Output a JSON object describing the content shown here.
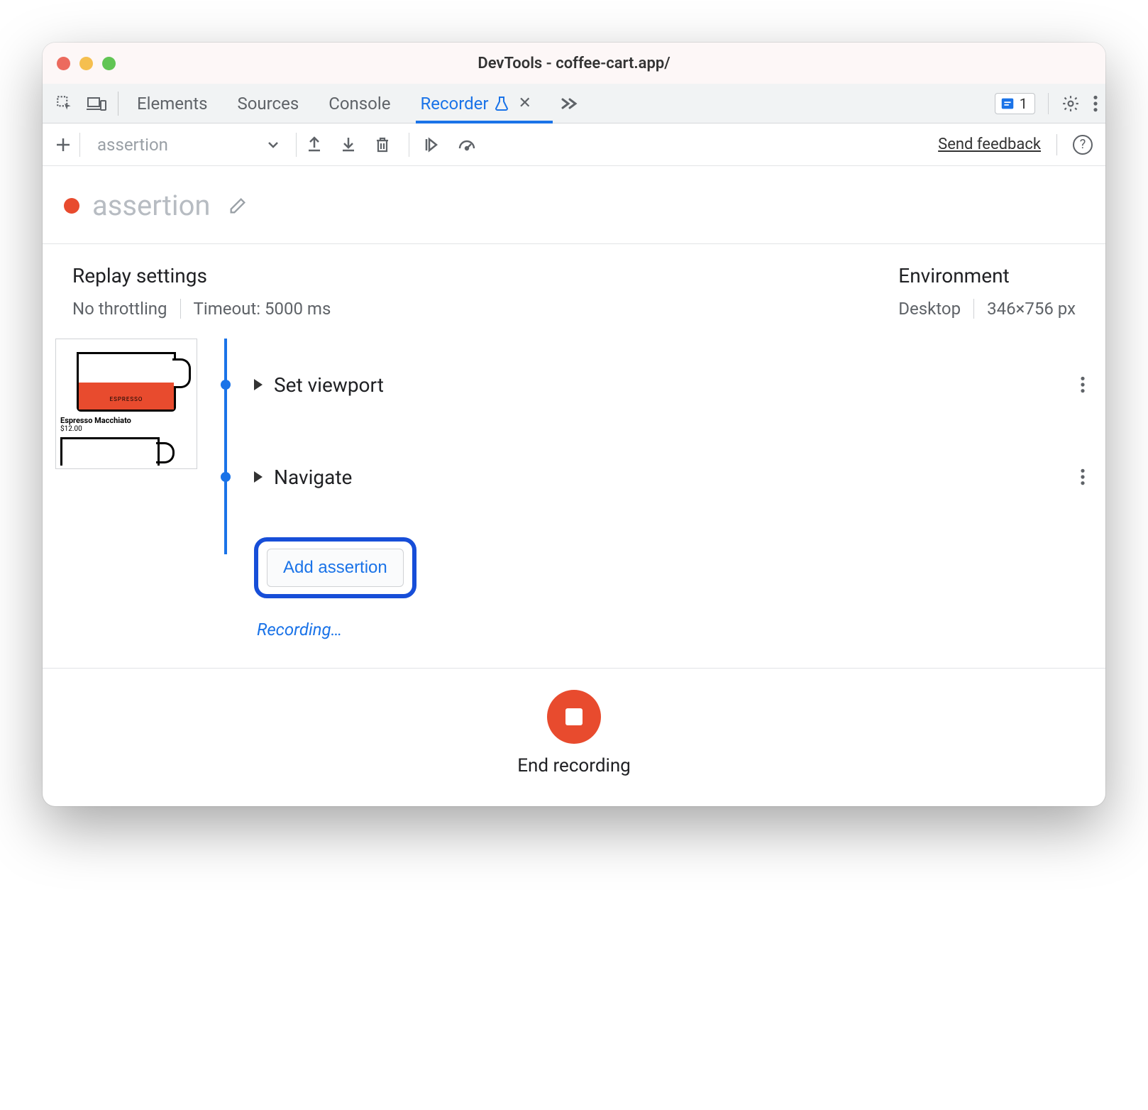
{
  "window": {
    "title": "DevTools - coffee-cart.app/"
  },
  "tabstrip": {
    "tabs": {
      "elements": "Elements",
      "sources": "Sources",
      "console": "Console",
      "recorder": "Recorder"
    },
    "issues_count": "1"
  },
  "subtoolbar": {
    "recording_name": "assertion",
    "send_feedback": "Send feedback"
  },
  "recording": {
    "title": "assertion"
  },
  "replay_settings": {
    "heading": "Replay settings",
    "throttling": "No throttling",
    "timeout": "Timeout: 5000 ms"
  },
  "environment": {
    "heading": "Environment",
    "device": "Desktop",
    "viewport": "346×756 px"
  },
  "thumbnail": {
    "label": "Espresso Macchiato",
    "price": "$12.00",
    "cup_label": "ESPRESSO"
  },
  "steps": {
    "set_viewport": "Set viewport",
    "navigate": "Navigate",
    "add_assertion": "Add assertion",
    "recording_status": "Recording…"
  },
  "footer": {
    "end_recording": "End recording"
  }
}
